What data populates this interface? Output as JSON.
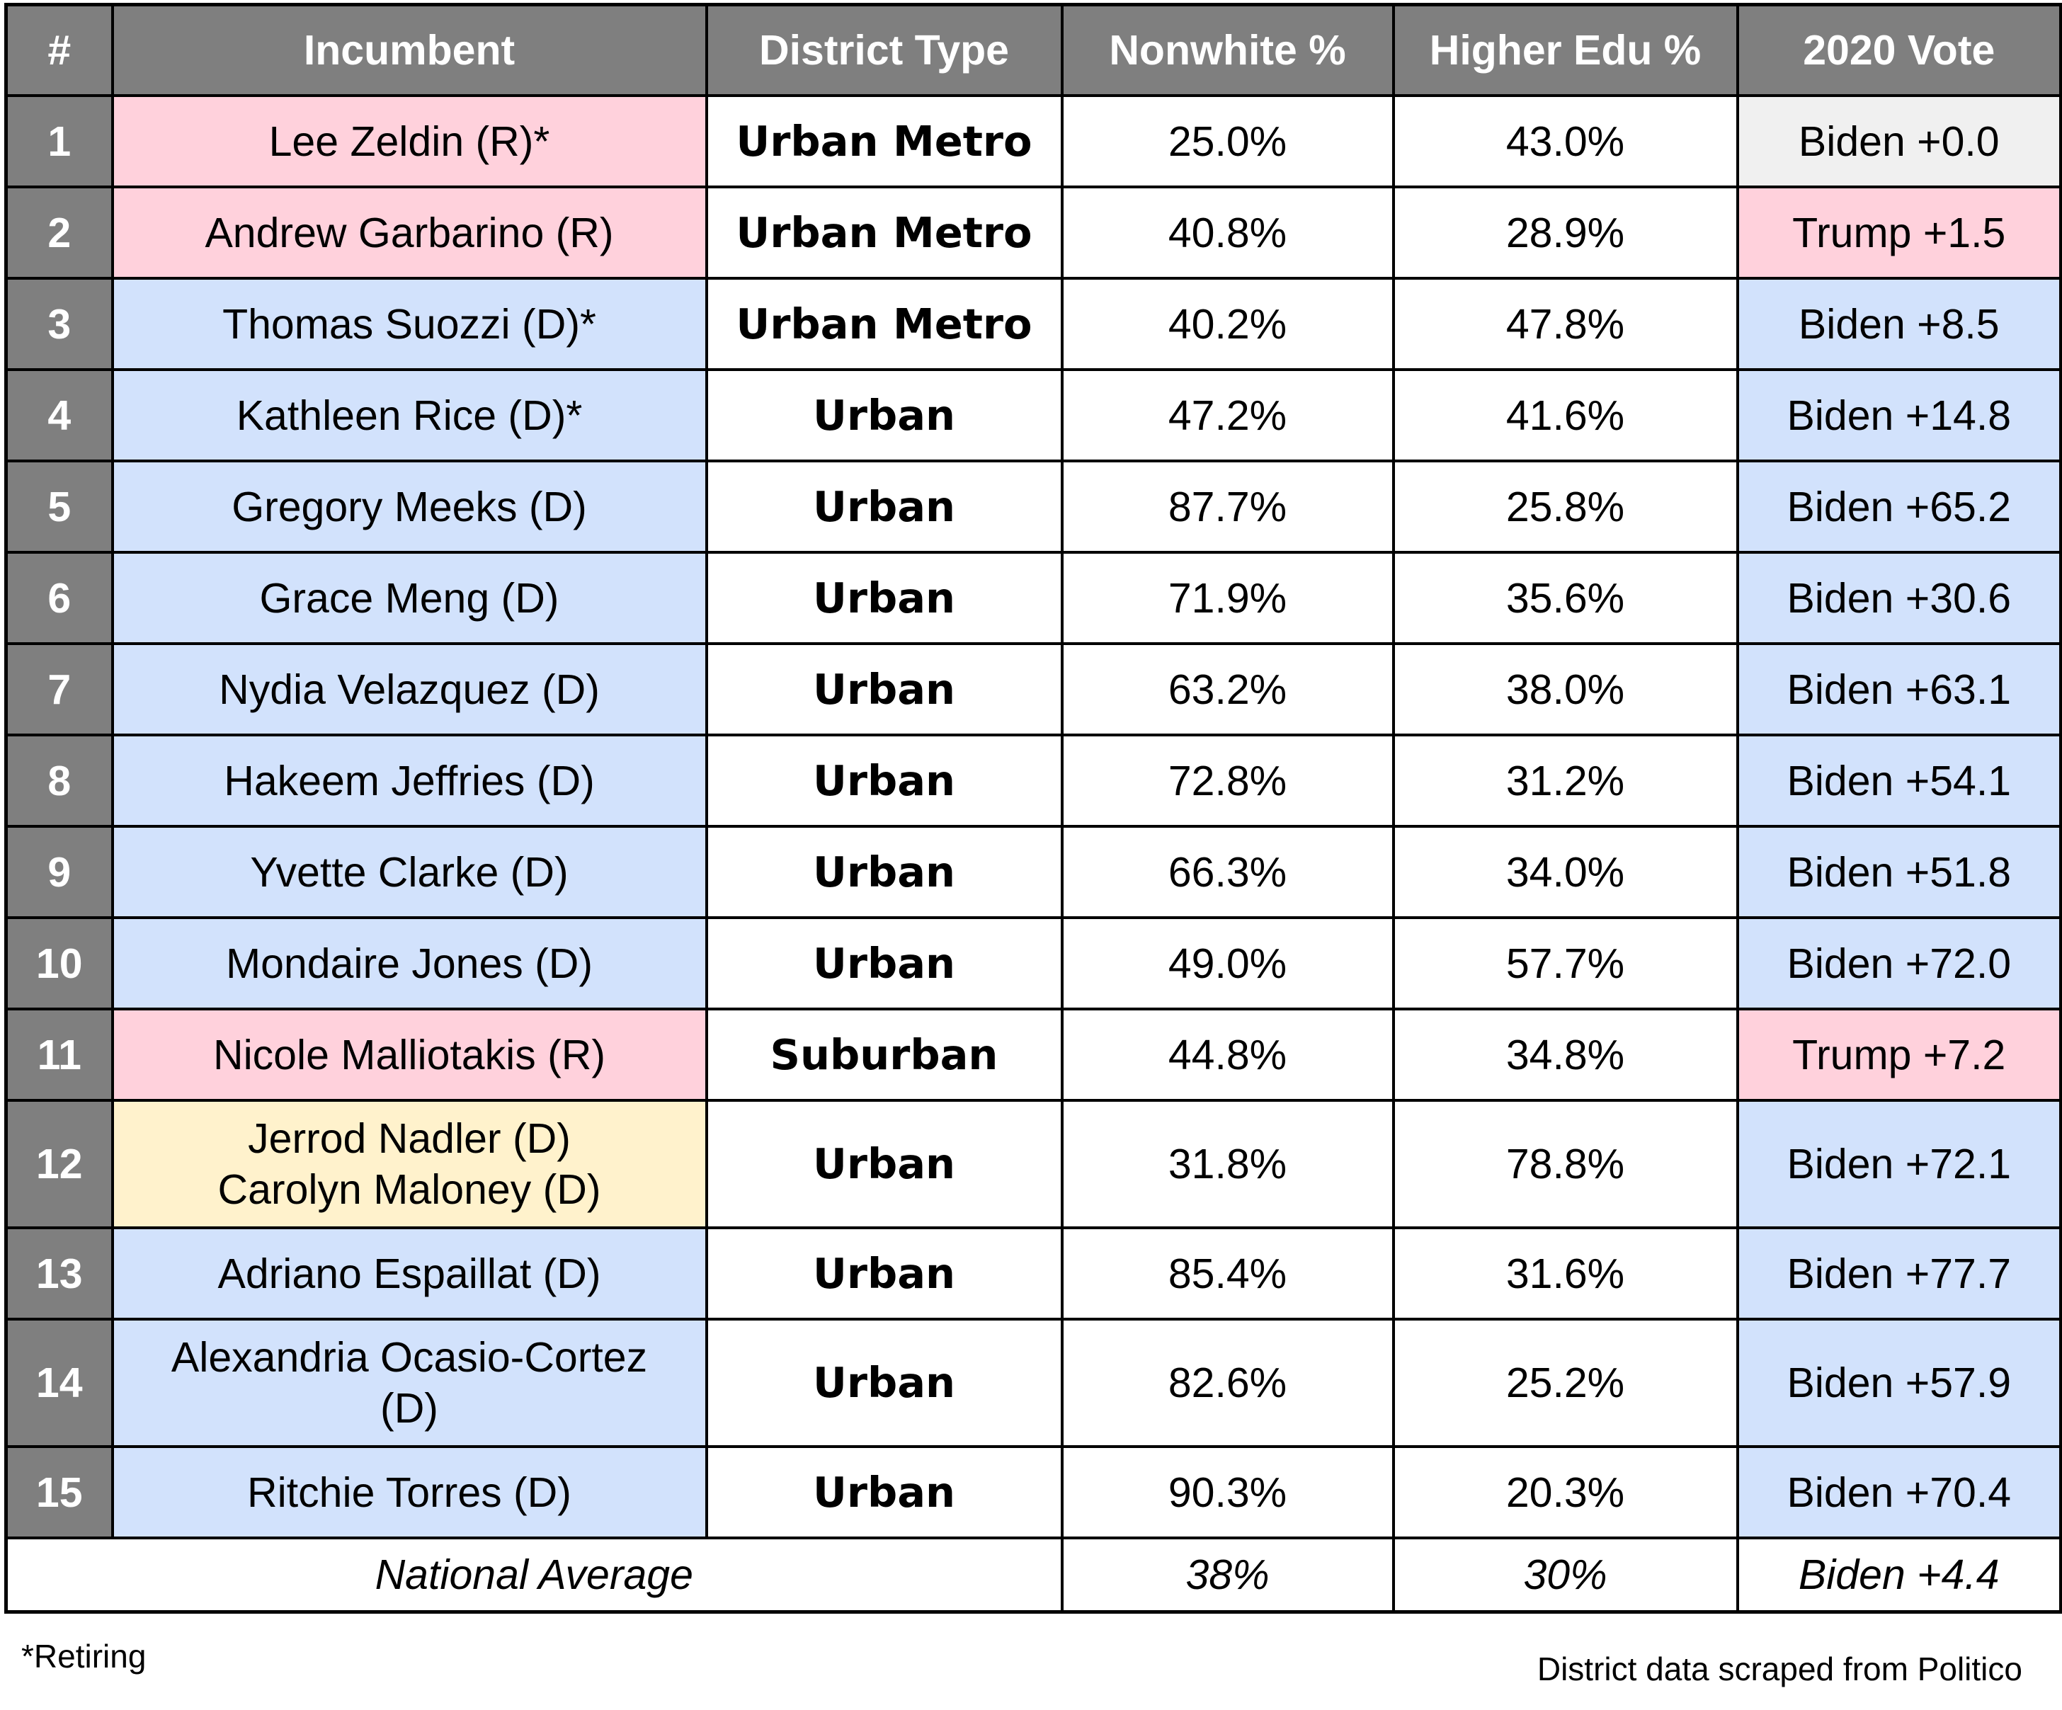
{
  "table": {
    "headers": [
      "#",
      "Incumbent",
      "District Type",
      "Nonwhite %",
      "Higher Edu %",
      "2020 Vote"
    ],
    "party_colors": {
      "R": "#ffd1dc",
      "D": "#d2e2fc",
      "shared": "#fff2cc",
      "neutral": "#f0f0f0",
      "header": "#7f7f7f"
    },
    "rows": [
      {
        "num": "1",
        "incumbent": "Lee Zeldin (R)*",
        "incumbent_party": "R",
        "district_type": "Urban Metro",
        "nonwhite": "25.0%",
        "higher_edu": "43.0%",
        "vote": "Biden +0.0",
        "vote_lean": "neutral"
      },
      {
        "num": "2",
        "incumbent": "Andrew Garbarino (R)",
        "incumbent_party": "R",
        "district_type": "Urban Metro",
        "nonwhite": "40.8%",
        "higher_edu": "28.9%",
        "vote": "Trump +1.5",
        "vote_lean": "R"
      },
      {
        "num": "3",
        "incumbent": "Thomas Suozzi (D)*",
        "incumbent_party": "D",
        "district_type": "Urban Metro",
        "nonwhite": "40.2%",
        "higher_edu": "47.8%",
        "vote": "Biden +8.5",
        "vote_lean": "D"
      },
      {
        "num": "4",
        "incumbent": "Kathleen Rice (D)*",
        "incumbent_party": "D",
        "district_type": "Urban",
        "nonwhite": "47.2%",
        "higher_edu": "41.6%",
        "vote": "Biden +14.8",
        "vote_lean": "D"
      },
      {
        "num": "5",
        "incumbent": "Gregory Meeks (D)",
        "incumbent_party": "D",
        "district_type": "Urban",
        "nonwhite": "87.7%",
        "higher_edu": "25.8%",
        "vote": "Biden +65.2",
        "vote_lean": "D"
      },
      {
        "num": "6",
        "incumbent": "Grace Meng (D)",
        "incumbent_party": "D",
        "district_type": "Urban",
        "nonwhite": "71.9%",
        "higher_edu": "35.6%",
        "vote": "Biden +30.6",
        "vote_lean": "D"
      },
      {
        "num": "7",
        "incumbent": "Nydia Velazquez (D)",
        "incumbent_party": "D",
        "district_type": "Urban",
        "nonwhite": "63.2%",
        "higher_edu": "38.0%",
        "vote": "Biden +63.1",
        "vote_lean": "D"
      },
      {
        "num": "8",
        "incumbent": "Hakeem Jeffries (D)",
        "incumbent_party": "D",
        "district_type": "Urban",
        "nonwhite": "72.8%",
        "higher_edu": "31.2%",
        "vote": "Biden +54.1",
        "vote_lean": "D"
      },
      {
        "num": "9",
        "incumbent": "Yvette Clarke (D)",
        "incumbent_party": "D",
        "district_type": "Urban",
        "nonwhite": "66.3%",
        "higher_edu": "34.0%",
        "vote": "Biden +51.8",
        "vote_lean": "D"
      },
      {
        "num": "10",
        "incumbent": "Mondaire Jones (D)",
        "incumbent_party": "D",
        "district_type": "Urban",
        "nonwhite": "49.0%",
        "higher_edu": "57.7%",
        "vote": "Biden +72.0",
        "vote_lean": "D"
      },
      {
        "num": "11",
        "incumbent": "Nicole Malliotakis (R)",
        "incumbent_party": "R",
        "district_type": "Suburban",
        "nonwhite": "44.8%",
        "higher_edu": "34.8%",
        "vote": "Trump +7.2",
        "vote_lean": "R"
      },
      {
        "num": "12",
        "incumbent": "Jerrod Nadler (D)",
        "incumbent_line2": "Carolyn Maloney (D)",
        "incumbent_party": "shared",
        "district_type": "Urban",
        "nonwhite": "31.8%",
        "higher_edu": "78.8%",
        "vote": "Biden +72.1",
        "vote_lean": "D"
      },
      {
        "num": "13",
        "incumbent": "Adriano Espaillat (D)",
        "incumbent_party": "D",
        "district_type": "Urban",
        "nonwhite": "85.4%",
        "higher_edu": "31.6%",
        "vote": "Biden +77.7",
        "vote_lean": "D"
      },
      {
        "num": "14",
        "incumbent": "Alexandria Ocasio-Cortez",
        "incumbent_line2": "(D)",
        "incumbent_party": "D",
        "district_type": "Urban",
        "nonwhite": "82.6%",
        "higher_edu": "25.2%",
        "vote": "Biden +57.9",
        "vote_lean": "D"
      },
      {
        "num": "15",
        "incumbent": "Ritchie Torres (D)",
        "incumbent_party": "D",
        "district_type": "Urban",
        "nonwhite": "90.3%",
        "higher_edu": "20.3%",
        "vote": "Biden +70.4",
        "vote_lean": "D"
      }
    ],
    "national_average": {
      "label": "National Average",
      "nonwhite": "38%",
      "higher_edu": "30%",
      "vote": "Biden +4.4"
    }
  },
  "footnote": "*Retiring",
  "credit": "District data scraped from Politico"
}
